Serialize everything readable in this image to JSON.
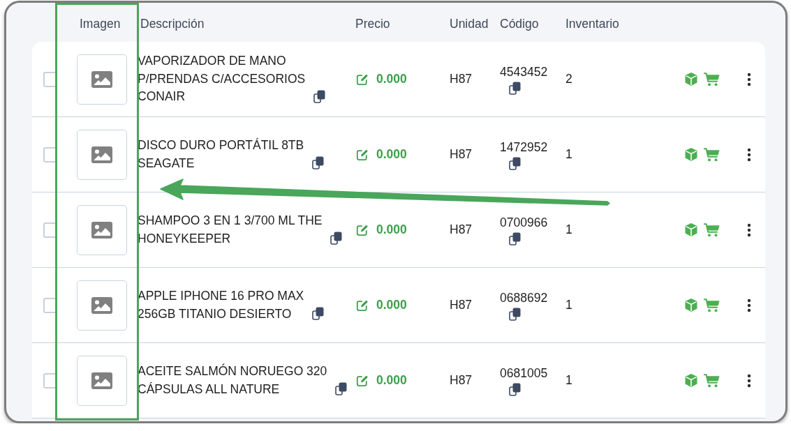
{
  "table": {
    "columns": [
      {
        "label": "Imagen"
      },
      {
        "label": "Descripción"
      },
      {
        "label": "Precio"
      },
      {
        "label": "Unidad"
      },
      {
        "label": "Código"
      },
      {
        "label": "Inventario"
      }
    ],
    "rows": [
      {
        "checked": false,
        "description": "VAPORIZADOR DE MANO P/PRENDAS C/ACCESORIOS CONAIR",
        "price": "0.000",
        "unit": "H87",
        "code": "4543452",
        "inventory": "2"
      },
      {
        "checked": false,
        "description": "DISCO DURO PORTÁTIL 8TB SEAGATE",
        "price": "0.000",
        "unit": "H87",
        "code": "1472952",
        "inventory": "1"
      },
      {
        "checked": false,
        "description": "SHAMPOO 3 EN 1 3/700 ML THE HONEYKEEPER",
        "price": "0.000",
        "unit": "H87",
        "code": "0700966",
        "inventory": "1"
      },
      {
        "checked": false,
        "description": "APPLE IPHONE 16 PRO MAX 256GB TITANIO DESIERTO",
        "price": "0.000",
        "unit": "H87",
        "code": "0688692",
        "inventory": "1"
      },
      {
        "checked": false,
        "description": "ACEITE SALMÓN NORUEGO 320 CÁPSULAS ALL NATURE",
        "price": "0.000",
        "unit": "H87",
        "code": "0681005",
        "inventory": "1"
      }
    ]
  },
  "annotations": {
    "image_column_frame": true,
    "arrow": true
  }
}
